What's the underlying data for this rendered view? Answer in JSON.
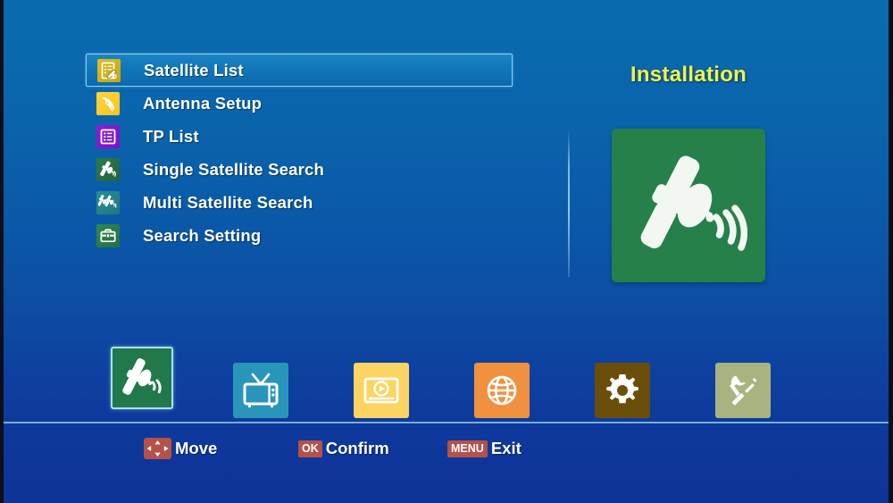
{
  "screen": {
    "title": "Installation"
  },
  "menu": {
    "items": [
      {
        "label": "Satellite List",
        "icon": "satellite-list-icon",
        "selected": true
      },
      {
        "label": "Antenna Setup",
        "icon": "antenna-setup-icon",
        "selected": false
      },
      {
        "label": "TP List",
        "icon": "tp-list-icon",
        "selected": false
      },
      {
        "label": "Single Satellite Search",
        "icon": "single-satellite-search-icon",
        "selected": false
      },
      {
        "label": "Multi Satellite Search",
        "icon": "multi-satellite-search-icon",
        "selected": false
      },
      {
        "label": "Search Setting",
        "icon": "search-setting-icon",
        "selected": false
      }
    ]
  },
  "panel": {
    "title": "Installation",
    "graphic_icon": "satellite-dish-icon",
    "graphic_color": "#268049",
    "title_color": "#f2f24a"
  },
  "toolbar": {
    "items": [
      {
        "name": "installation",
        "icon": "satellite-icon",
        "color": "#21784a",
        "selected": true
      },
      {
        "name": "channel",
        "icon": "tv-icon",
        "color": "#2a95bb",
        "selected": false
      },
      {
        "name": "media",
        "icon": "media-play-icon",
        "color": "#fcd462",
        "selected": false
      },
      {
        "name": "network",
        "icon": "globe-icon",
        "color": "#f0913f",
        "selected": false
      },
      {
        "name": "system",
        "icon": "gear-icon",
        "color": "#6b4d0a",
        "selected": false
      },
      {
        "name": "tools",
        "icon": "tools-icon",
        "color": "#a8b380",
        "selected": false
      }
    ]
  },
  "help": [
    {
      "key": "arrows",
      "key_label": "",
      "action": "Move"
    },
    {
      "key": "ok",
      "key_label": "OK",
      "action": "Confirm"
    },
    {
      "key": "menu",
      "key_label": "MENU",
      "action": "Exit"
    }
  ],
  "colors": {
    "background_top": "#0a6cae",
    "background_bottom": "#0f3399",
    "selection_border": "#8fd2f0",
    "key_badge": "#b4524a"
  }
}
